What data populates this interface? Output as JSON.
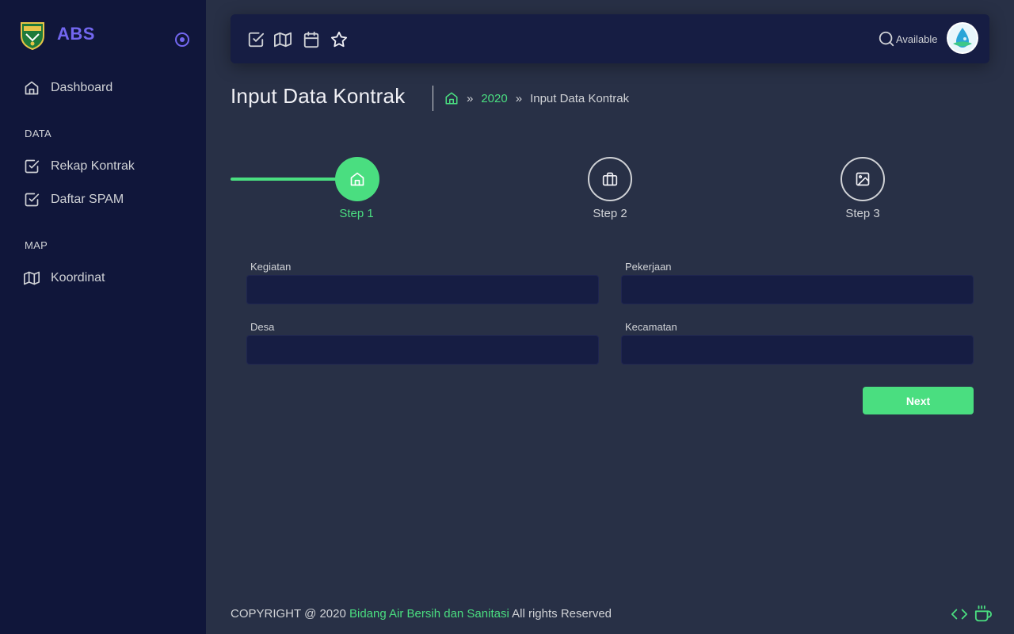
{
  "app": {
    "name": "ABS"
  },
  "sidebar": {
    "items": [
      {
        "label": "Dashboard"
      },
      {
        "label": "Rekap Kontrak"
      },
      {
        "label": "Daftar SPAM"
      },
      {
        "label": "Koordinat"
      }
    ],
    "headers": [
      "DATA",
      "MAP"
    ]
  },
  "topbar": {
    "icons": [
      "check-square-icon",
      "map-icon",
      "calendar-icon",
      "star-icon"
    ],
    "status": "Available"
  },
  "page": {
    "title": "Input Data Kontrak",
    "breadcrumb": {
      "year": "2020",
      "current": "Input Data Kontrak"
    }
  },
  "stepper": {
    "steps": [
      {
        "label": "Step 1",
        "icon": "home-icon",
        "state": "active"
      },
      {
        "label": "Step 2",
        "icon": "briefcase-icon",
        "state": "inactive"
      },
      {
        "label": "Step 3",
        "icon": "image-icon",
        "state": "inactive"
      }
    ]
  },
  "form": {
    "fields": [
      {
        "label": "Kegiatan",
        "value": ""
      },
      {
        "label": "Pekerjaan",
        "value": ""
      },
      {
        "label": "Desa",
        "value": ""
      },
      {
        "label": "Kecamatan",
        "value": ""
      }
    ],
    "next_label": "Next"
  },
  "footer": {
    "prefix": "COPYRIGHT @ 2020 ",
    "org": "Bidang Air Bersih dan Sanitasi",
    "suffix": " All rights Reserved"
  },
  "colors": {
    "sidebar_bg": "#10163a",
    "content_bg": "#283046",
    "accent": "#7367f0",
    "success": "#4ade80",
    "input_bg": "#161d43"
  }
}
